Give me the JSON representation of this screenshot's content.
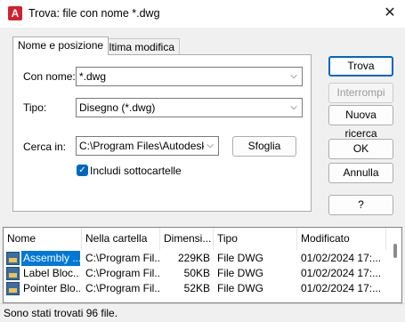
{
  "window": {
    "title": "Trova: file con nome *.dwg",
    "app_icon_letter": "A"
  },
  "tabs": [
    {
      "label": "Nome e posizione",
      "active": true
    },
    {
      "label": "Ultima modifica",
      "active": false
    }
  ],
  "form": {
    "name_label": "Con nome:",
    "name_value": "*.dwg",
    "type_label": "Tipo:",
    "type_value": "Disegno (*.dwg)",
    "lookin_label": "Cerca in:",
    "lookin_value": "C:\\Program Files\\Autodesk\\A",
    "browse_label": "Sfoglia",
    "subfolders_label": "Includi sottocartelle",
    "subfolders_checked": true
  },
  "buttons": {
    "find": "Trova",
    "stop": "Interrompi",
    "new_search": "Nuova ricerca",
    "ok": "OK",
    "cancel": "Annulla",
    "help": "?"
  },
  "results": {
    "columns": [
      "Nome",
      "Nella cartella",
      "Dimensi...",
      "Tipo",
      "Modificato"
    ],
    "rows": [
      {
        "name": "Assembly ...",
        "folder": "C:\\Program Fil...",
        "size": "229KB",
        "type": "File DWG",
        "modified": "01/02/2024 17:...",
        "selected": true
      },
      {
        "name": "Label Bloc...",
        "folder": "C:\\Program Fil...",
        "size": "50KB",
        "type": "File DWG",
        "modified": "01/02/2024 17:...",
        "selected": false
      },
      {
        "name": "Pointer Blo...",
        "folder": "C:\\Program Fil...",
        "size": "52KB",
        "type": "File DWG",
        "modified": "01/02/2024 17:...",
        "selected": false
      }
    ]
  },
  "status": "Sono stati trovati 96 file."
}
